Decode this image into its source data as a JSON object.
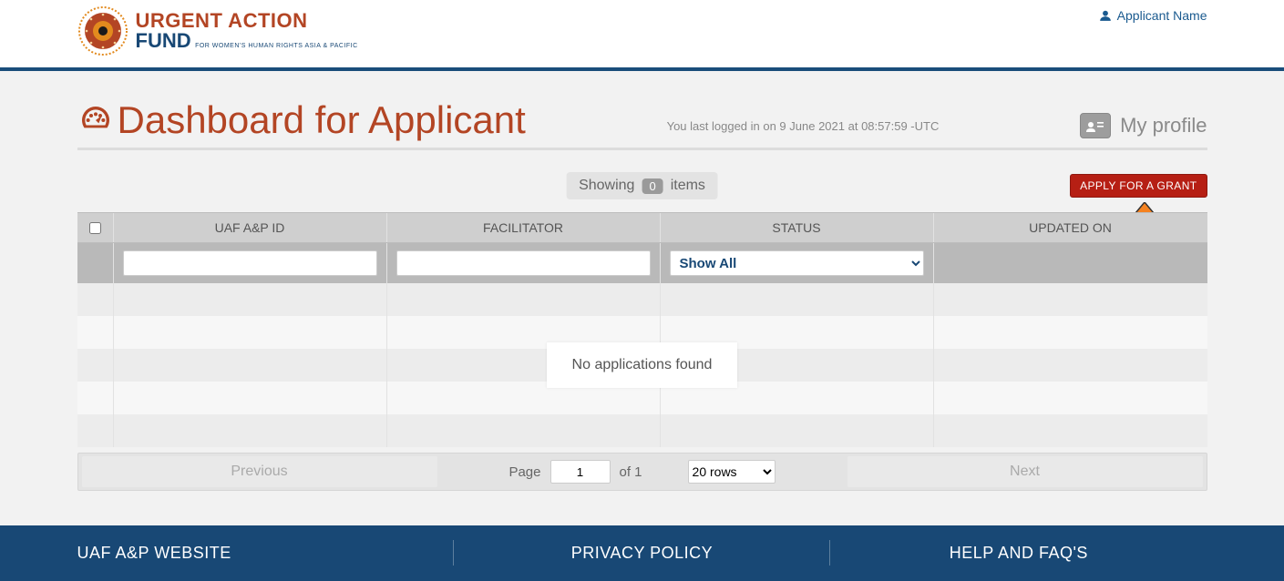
{
  "header": {
    "logo_line1": "URGENT ACTION",
    "logo_line2": "FUND",
    "logo_sub": "FOR WOMEN'S HUMAN RIGHTS ASIA & PACIFIC",
    "applicant_link": "Applicant Name"
  },
  "main": {
    "title": "Dashboard for Applicant",
    "last_login": "You last logged in on 9 June 2021 at 08:57:59 -UTC",
    "my_profile": "My profile"
  },
  "toolbar": {
    "showing_label": "Showing",
    "count": "0",
    "items_label": "items",
    "apply_label": "APPLY FOR A GRANT"
  },
  "table": {
    "columns": {
      "id": "UAF A&P ID",
      "facilitator": "FACILITATOR",
      "status": "STATUS",
      "updated": "UPDATED ON"
    },
    "filters": {
      "id_value": "",
      "facilitator_value": "",
      "status_selected": "Show All"
    },
    "empty_message": "No applications found"
  },
  "pagination": {
    "previous": "Previous",
    "page_label": "Page",
    "page_value": "1",
    "of_label": "of 1",
    "rows_selected": "20 rows",
    "next": "Next"
  },
  "footer": {
    "links": {
      "website": "UAF A&P WEBSITE",
      "privacy": "PRIVACY POLICY",
      "help": "HELP AND FAQ'S"
    }
  }
}
